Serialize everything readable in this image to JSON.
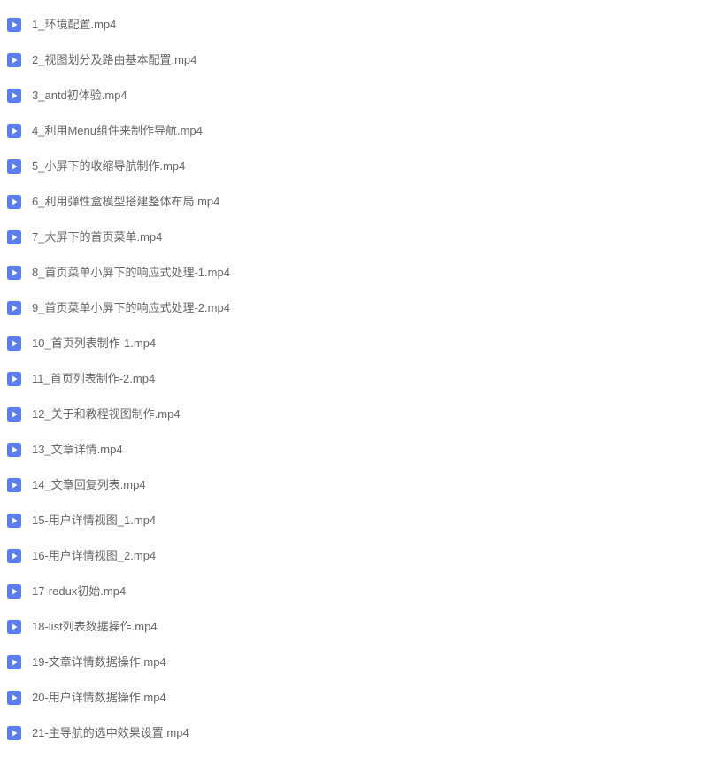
{
  "files": [
    {
      "name": "1_环境配置.mp4"
    },
    {
      "name": "2_视图划分及路由基本配置.mp4"
    },
    {
      "name": "3_antd初体验.mp4"
    },
    {
      "name": "4_利用Menu组件来制作导航.mp4"
    },
    {
      "name": "5_小屏下的收缩导航制作.mp4"
    },
    {
      "name": "6_利用弹性盒模型搭建整体布局.mp4"
    },
    {
      "name": "7_大屏下的首页菜单.mp4"
    },
    {
      "name": "8_首页菜单小屏下的响应式处理-1.mp4"
    },
    {
      "name": "9_首页菜单小屏下的响应式处理-2.mp4"
    },
    {
      "name": "10_首页列表制作-1.mp4"
    },
    {
      "name": "11_首页列表制作-2.mp4"
    },
    {
      "name": "12_关于和教程视图制作.mp4"
    },
    {
      "name": "13_文章详情.mp4"
    },
    {
      "name": "14_文章回复列表.mp4"
    },
    {
      "name": "15-用户详情视图_1.mp4"
    },
    {
      "name": "16-用户详情视图_2.mp4"
    },
    {
      "name": "17-redux初始.mp4"
    },
    {
      "name": "18-list列表数据操作.mp4"
    },
    {
      "name": "19-文章详情数据操作.mp4"
    },
    {
      "name": "20-用户详情数据操作.mp4"
    },
    {
      "name": "21-主导航的选中效果设置.mp4"
    }
  ]
}
